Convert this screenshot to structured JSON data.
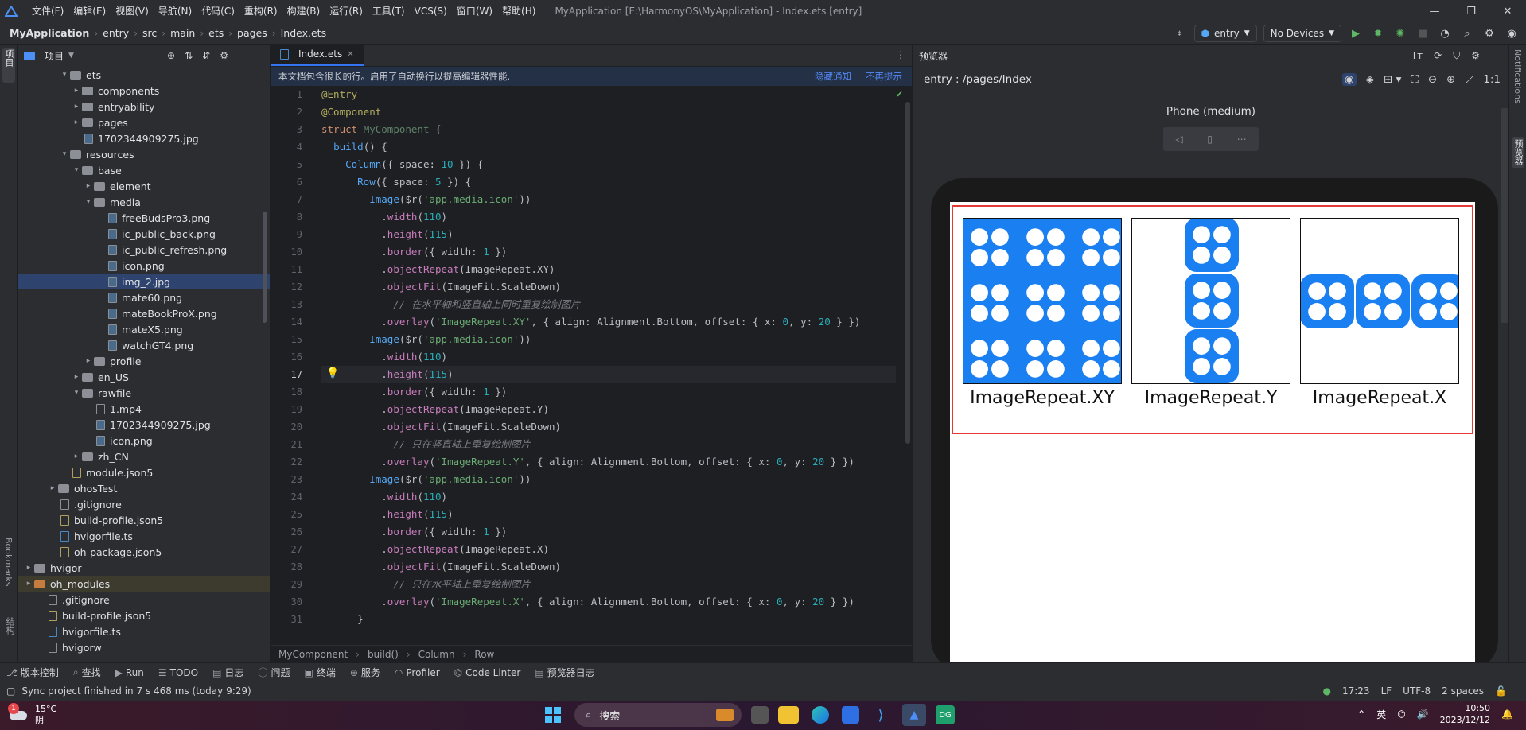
{
  "menu": [
    "文件(F)",
    "编辑(E)",
    "视图(V)",
    "导航(N)",
    "代码(C)",
    "重构(R)",
    "构建(B)",
    "运行(R)",
    "工具(T)",
    "VCS(S)",
    "窗口(W)",
    "帮助(H)"
  ],
  "window_title": "MyApplication [E:\\HarmonyOS\\MyApplication] - Index.ets [entry]",
  "breadcrumb": [
    "MyApplication",
    "entry",
    "src",
    "main",
    "ets",
    "pages",
    "Index.ets"
  ],
  "run_config": "entry",
  "device_combo": "No Devices",
  "project_panel": {
    "title": "项目"
  },
  "tree": [
    {
      "label": "ets",
      "depth": 4,
      "type": "folder",
      "open": true
    },
    {
      "label": "components",
      "depth": 5,
      "type": "folder",
      "open": false
    },
    {
      "label": "entryability",
      "depth": 5,
      "type": "folder",
      "open": false
    },
    {
      "label": "pages",
      "depth": 5,
      "type": "folder",
      "open": false
    },
    {
      "label": "1702344909275.jpg",
      "depth": 5,
      "type": "img",
      "leaf": true
    },
    {
      "label": "resources",
      "depth": 4,
      "type": "folder",
      "open": true
    },
    {
      "label": "base",
      "depth": 5,
      "type": "folder",
      "open": true
    },
    {
      "label": "element",
      "depth": 6,
      "type": "folder",
      "open": false
    },
    {
      "label": "media",
      "depth": 6,
      "type": "folder",
      "open": true
    },
    {
      "label": "freeBudsPro3.png",
      "depth": 7,
      "type": "img",
      "leaf": true
    },
    {
      "label": "ic_public_back.png",
      "depth": 7,
      "type": "img",
      "leaf": true
    },
    {
      "label": "ic_public_refresh.png",
      "depth": 7,
      "type": "img",
      "leaf": true
    },
    {
      "label": "icon.png",
      "depth": 7,
      "type": "img",
      "leaf": true
    },
    {
      "label": "img_2.jpg",
      "depth": 7,
      "type": "img",
      "leaf": true,
      "selected": true
    },
    {
      "label": "mate60.png",
      "depth": 7,
      "type": "img",
      "leaf": true
    },
    {
      "label": "mateBookProX.png",
      "depth": 7,
      "type": "img",
      "leaf": true
    },
    {
      "label": "mateX5.png",
      "depth": 7,
      "type": "img",
      "leaf": true
    },
    {
      "label": "watchGT4.png",
      "depth": 7,
      "type": "img",
      "leaf": true
    },
    {
      "label": "profile",
      "depth": 6,
      "type": "folder",
      "open": false
    },
    {
      "label": "en_US",
      "depth": 5,
      "type": "folder",
      "open": false
    },
    {
      "label": "rawfile",
      "depth": 5,
      "type": "folder",
      "open": true
    },
    {
      "label": "1.mp4",
      "depth": 6,
      "type": "file",
      "leaf": true
    },
    {
      "label": "1702344909275.jpg",
      "depth": 6,
      "type": "img",
      "leaf": true
    },
    {
      "label": "icon.png",
      "depth": 6,
      "type": "img",
      "leaf": true
    },
    {
      "label": "zh_CN",
      "depth": 5,
      "type": "folder",
      "open": false
    },
    {
      "label": "module.json5",
      "depth": 4,
      "type": "js",
      "leaf": true
    },
    {
      "label": "ohosTest",
      "depth": 3,
      "type": "folder",
      "open": false
    },
    {
      "label": ".gitignore",
      "depth": 3,
      "type": "file",
      "leaf": true
    },
    {
      "label": "build-profile.json5",
      "depth": 3,
      "type": "js",
      "leaf": true
    },
    {
      "label": "hvigorfile.ts",
      "depth": 3,
      "type": "ts",
      "leaf": true
    },
    {
      "label": "oh-package.json5",
      "depth": 3,
      "type": "js",
      "leaf": true
    },
    {
      "label": "hvigor",
      "depth": 1,
      "type": "folder",
      "open": false
    },
    {
      "label": "oh_modules",
      "depth": 1,
      "type": "folder",
      "open": false,
      "orange": true,
      "highlight": true
    },
    {
      "label": ".gitignore",
      "depth": 2,
      "type": "file",
      "leaf": true
    },
    {
      "label": "build-profile.json5",
      "depth": 2,
      "type": "js",
      "leaf": true
    },
    {
      "label": "hvigorfile.ts",
      "depth": 2,
      "type": "ts",
      "leaf": true
    },
    {
      "label": "hvigorw",
      "depth": 2,
      "type": "file",
      "leaf": true
    }
  ],
  "editor": {
    "tab": "Index.ets",
    "notice": "本文档包含很长的行。启用了自动换行以提高编辑器性能.",
    "notice_hide": "隐藏通知",
    "notice_never": "不再提示",
    "current_line": 17,
    "lines": [
      [
        [
          "a",
          "@Entry"
        ]
      ],
      [
        [
          "a",
          "@Component"
        ]
      ],
      [
        [
          "k",
          "struct "
        ],
        [
          "cls",
          "MyComponent"
        ],
        [
          "t",
          " {"
        ]
      ],
      [
        [
          "t",
          "  "
        ],
        [
          "f",
          "build"
        ],
        [
          "t",
          "() {"
        ]
      ],
      [
        [
          "t",
          "    "
        ],
        [
          "f",
          "Column"
        ],
        [
          "t",
          "({ space: "
        ],
        [
          "n",
          "10"
        ],
        [
          "t",
          " }) {"
        ]
      ],
      [
        [
          "t",
          "      "
        ],
        [
          "f",
          "Row"
        ],
        [
          "t",
          "({ space: "
        ],
        [
          "n",
          "5"
        ],
        [
          "t",
          " }) {"
        ]
      ],
      [
        [
          "t",
          "        "
        ],
        [
          "f",
          "Image"
        ],
        [
          "t",
          "($r("
        ],
        [
          "s",
          "'app.media.icon'"
        ],
        [
          "t",
          "))"
        ]
      ],
      [
        [
          "t",
          "          ."
        ],
        [
          "p",
          "width"
        ],
        [
          "t",
          "("
        ],
        [
          "n",
          "110"
        ],
        [
          "t",
          ")"
        ]
      ],
      [
        [
          "t",
          "          ."
        ],
        [
          "p",
          "height"
        ],
        [
          "t",
          "("
        ],
        [
          "n",
          "115"
        ],
        [
          "t",
          ")"
        ]
      ],
      [
        [
          "t",
          "          ."
        ],
        [
          "p",
          "border"
        ],
        [
          "t",
          "({ width: "
        ],
        [
          "n",
          "1"
        ],
        [
          "t",
          " })"
        ]
      ],
      [
        [
          "t",
          "          ."
        ],
        [
          "p",
          "objectRepeat"
        ],
        [
          "t",
          "(ImageRepeat.XY)"
        ]
      ],
      [
        [
          "t",
          "          ."
        ],
        [
          "p",
          "objectFit"
        ],
        [
          "t",
          "(ImageFit.ScaleDown)"
        ]
      ],
      [
        [
          "c",
          "            // 在水平轴和竖直轴上同时重复绘制图片"
        ]
      ],
      [
        [
          "t",
          "          ."
        ],
        [
          "p",
          "overlay"
        ],
        [
          "t",
          "("
        ],
        [
          "s",
          "'ImageRepeat.XY'"
        ],
        [
          "t",
          ", { align: Alignment.Bottom, offset: { x: "
        ],
        [
          "n",
          "0"
        ],
        [
          "t",
          ", y: "
        ],
        [
          "n",
          "20"
        ],
        [
          "t",
          " } })"
        ]
      ],
      [
        [
          "t",
          "        "
        ],
        [
          "f",
          "Image"
        ],
        [
          "t",
          "($r("
        ],
        [
          "s",
          "'app.media.icon'"
        ],
        [
          "t",
          "))"
        ]
      ],
      [
        [
          "t",
          "          ."
        ],
        [
          "p",
          "width"
        ],
        [
          "t",
          "("
        ],
        [
          "n",
          "110"
        ],
        [
          "t",
          ")"
        ]
      ],
      [
        [
          "t",
          "          ."
        ],
        [
          "p",
          "height"
        ],
        [
          "t",
          "("
        ],
        [
          "n",
          "115"
        ],
        [
          "t",
          ")"
        ]
      ],
      [
        [
          "t",
          "          ."
        ],
        [
          "p",
          "border"
        ],
        [
          "t",
          "({ width: "
        ],
        [
          "n",
          "1"
        ],
        [
          "t",
          " })"
        ]
      ],
      [
        [
          "t",
          "          ."
        ],
        [
          "p",
          "objectRepeat"
        ],
        [
          "t",
          "(ImageRepeat.Y)"
        ]
      ],
      [
        [
          "t",
          "          ."
        ],
        [
          "p",
          "objectFit"
        ],
        [
          "t",
          "(ImageFit.ScaleDown)"
        ]
      ],
      [
        [
          "c",
          "            // 只在竖直轴上重复绘制图片"
        ]
      ],
      [
        [
          "t",
          "          ."
        ],
        [
          "p",
          "overlay"
        ],
        [
          "t",
          "("
        ],
        [
          "s",
          "'ImageRepeat.Y'"
        ],
        [
          "t",
          ", { align: Alignment.Bottom, offset: { x: "
        ],
        [
          "n",
          "0"
        ],
        [
          "t",
          ", y: "
        ],
        [
          "n",
          "20"
        ],
        [
          "t",
          " } })"
        ]
      ],
      [
        [
          "t",
          "        "
        ],
        [
          "f",
          "Image"
        ],
        [
          "t",
          "($r("
        ],
        [
          "s",
          "'app.media.icon'"
        ],
        [
          "t",
          "))"
        ]
      ],
      [
        [
          "t",
          "          ."
        ],
        [
          "p",
          "width"
        ],
        [
          "t",
          "("
        ],
        [
          "n",
          "110"
        ],
        [
          "t",
          ")"
        ]
      ],
      [
        [
          "t",
          "          ."
        ],
        [
          "p",
          "height"
        ],
        [
          "t",
          "("
        ],
        [
          "n",
          "115"
        ],
        [
          "t",
          ")"
        ]
      ],
      [
        [
          "t",
          "          ."
        ],
        [
          "p",
          "border"
        ],
        [
          "t",
          "({ width: "
        ],
        [
          "n",
          "1"
        ],
        [
          "t",
          " })"
        ]
      ],
      [
        [
          "t",
          "          ."
        ],
        [
          "p",
          "objectRepeat"
        ],
        [
          "t",
          "(ImageRepeat.X)"
        ]
      ],
      [
        [
          "t",
          "          ."
        ],
        [
          "p",
          "objectFit"
        ],
        [
          "t",
          "(ImageFit.ScaleDown)"
        ]
      ],
      [
        [
          "c",
          "            // 只在水平轴上重复绘制图片"
        ]
      ],
      [
        [
          "t",
          "          ."
        ],
        [
          "p",
          "overlay"
        ],
        [
          "t",
          "("
        ],
        [
          "s",
          "'ImageRepeat.X'"
        ],
        [
          "t",
          ", { align: Alignment.Bottom, offset: { x: "
        ],
        [
          "n",
          "0"
        ],
        [
          "t",
          ", y: "
        ],
        [
          "n",
          "20"
        ],
        [
          "t",
          " } })"
        ]
      ],
      [
        [
          "t",
          "      }"
        ]
      ]
    ],
    "breadcrumb": [
      "MyComponent",
      "build()",
      "Column",
      "Row"
    ]
  },
  "preview": {
    "title": "预览器",
    "path": "entry : /pages/Index",
    "device": "Phone (medium)",
    "zoom": "1:1",
    "captions": [
      "ImageRepeat.XY",
      "ImageRepeat.Y",
      "ImageRepeat.X"
    ]
  },
  "right_strip": [
    "Notifications",
    "预览器"
  ],
  "left_strip": [
    "项目",
    "Bookmarks",
    "结构"
  ],
  "toolwindows": [
    "版本控制",
    "查找",
    "Run",
    "TODO",
    "日志",
    "问题",
    "终端",
    "服务",
    "Profiler",
    "Code Linter",
    "预览器日志"
  ],
  "status": {
    "message": "Sync project finished in 7 s 468 ms (today 9:29)",
    "position": "17:23",
    "line_sep": "LF",
    "encoding": "UTF-8",
    "indent": "2 spaces"
  },
  "taskbar": {
    "weather_temp": "15°C",
    "weather_desc": "阴",
    "weather_badge": "1",
    "search_label": "搜索",
    "ime": "英",
    "time": "10:50",
    "date": "2023/12/12"
  },
  "colors": {
    "accent": "#3574f0",
    "icon_blue": "#1a7ff0",
    "red_outline": "#e53935"
  }
}
